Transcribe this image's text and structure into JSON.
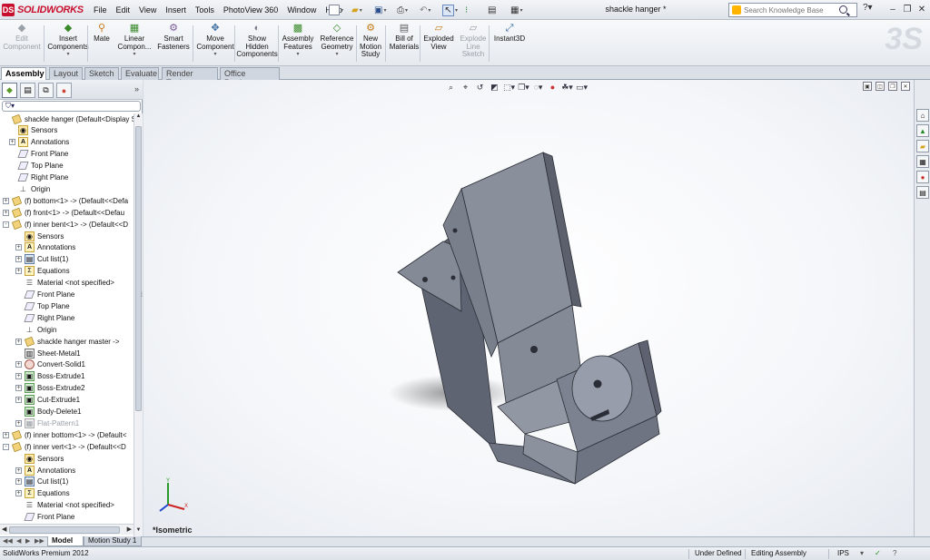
{
  "app": {
    "brand": "SOLIDWORKS",
    "brand_mark": "DS",
    "doc_title": "shackle hanger *"
  },
  "menu": [
    "File",
    "Edit",
    "View",
    "Insert",
    "Tools",
    "PhotoView 360",
    "Window",
    "Help"
  ],
  "search": {
    "placeholder": "Search Knowledge Base"
  },
  "commands": [
    {
      "l1": "Edit",
      "l2": "Component",
      "disabled": true
    },
    {
      "l1": "Insert",
      "l2": "Components",
      "disabled": false
    },
    {
      "l1": "Mate",
      "l2": "",
      "disabled": false
    },
    {
      "l1": "Linear",
      "l2": "Compon...",
      "disabled": false
    },
    {
      "l1": "Smart",
      "l2": "Fasteners",
      "disabled": false
    },
    {
      "l1": "Move",
      "l2": "Component",
      "disabled": false
    },
    {
      "l1": "Show",
      "l2": "Hidden",
      "l3": "Components",
      "disabled": false
    },
    {
      "l1": "Assembly",
      "l2": "Features",
      "disabled": false
    },
    {
      "l1": "Reference",
      "l2": "Geometry",
      "disabled": false
    },
    {
      "l1": "New",
      "l2": "Motion",
      "l3": "Study",
      "disabled": false
    },
    {
      "l1": "Bill of",
      "l2": "Materials",
      "disabled": false
    },
    {
      "l1": "Exploded",
      "l2": "View",
      "disabled": false
    },
    {
      "l1": "Explode",
      "l2": "Line",
      "l3": "Sketch",
      "disabled": true
    },
    {
      "l1": "Instant3D",
      "l2": "",
      "disabled": false
    }
  ],
  "tabs": [
    "Assembly",
    "Layout",
    "Sketch",
    "Evaluate",
    "Render Tools",
    "Office Products"
  ],
  "tree": [
    {
      "label": "shackle hanger  (Default<Display Stat",
      "icon": "assembly",
      "indent": 0,
      "exp": ""
    },
    {
      "label": "Sensors",
      "icon": "sensors",
      "indent": 1,
      "exp": ""
    },
    {
      "label": "Annotations",
      "icon": "annotations",
      "indent": 1,
      "exp": "+"
    },
    {
      "label": "Front Plane",
      "icon": "plane",
      "indent": 1,
      "exp": ""
    },
    {
      "label": "Top Plane",
      "icon": "plane",
      "indent": 1,
      "exp": ""
    },
    {
      "label": "Right Plane",
      "icon": "plane",
      "indent": 1,
      "exp": ""
    },
    {
      "label": "Origin",
      "icon": "origin",
      "indent": 1,
      "exp": ""
    },
    {
      "label": "(f) bottom<1> -> (Default<<Defa",
      "icon": "part",
      "indent": 0,
      "exp": "+"
    },
    {
      "label": "(f) front<1> -> (Default<<Defau",
      "icon": "part",
      "indent": 0,
      "exp": "+"
    },
    {
      "label": "(f) inner bent<1> -> (Default<<D",
      "icon": "part",
      "indent": 0,
      "exp": "-"
    },
    {
      "label": "Sensors",
      "icon": "sensors",
      "indent": 2,
      "exp": ""
    },
    {
      "label": "Annotations",
      "icon": "annotations",
      "indent": 2,
      "exp": "+"
    },
    {
      "label": "Cut list(1)",
      "icon": "cutlist",
      "indent": 2,
      "exp": "+"
    },
    {
      "label": "Equations",
      "icon": "equations",
      "indent": 2,
      "exp": "+"
    },
    {
      "label": "Material <not specified>",
      "icon": "material",
      "indent": 2,
      "exp": ""
    },
    {
      "label": "Front Plane",
      "icon": "plane",
      "indent": 2,
      "exp": ""
    },
    {
      "label": "Top Plane",
      "icon": "plane",
      "indent": 2,
      "exp": ""
    },
    {
      "label": "Right Plane",
      "icon": "plane",
      "indent": 2,
      "exp": ""
    },
    {
      "label": "Origin",
      "icon": "origin",
      "indent": 2,
      "exp": ""
    },
    {
      "label": "shackle hanger master ->",
      "icon": "part",
      "indent": 2,
      "exp": "+"
    },
    {
      "label": "Sheet-Metal1",
      "icon": "sheetmetal",
      "indent": 2,
      "exp": ""
    },
    {
      "label": "Convert-Solid1",
      "icon": "convert",
      "indent": 2,
      "exp": "+"
    },
    {
      "label": "Boss-Extrude1",
      "icon": "feature",
      "indent": 2,
      "exp": "+"
    },
    {
      "label": "Boss-Extrude2",
      "icon": "feature",
      "indent": 2,
      "exp": "+"
    },
    {
      "label": "Cut-Extrude1",
      "icon": "feature",
      "indent": 2,
      "exp": "+"
    },
    {
      "label": "Body-Delete1",
      "icon": "feature",
      "indent": 2,
      "exp": ""
    },
    {
      "label": "Flat-Pattern1",
      "icon": "flat",
      "indent": 2,
      "exp": "+",
      "dim": true
    },
    {
      "label": "(f) inner bottom<1> -> (Default<",
      "icon": "part",
      "indent": 0,
      "exp": "+"
    },
    {
      "label": "(f) inner vert<1> -> (Default<<D",
      "icon": "part",
      "indent": 0,
      "exp": "-"
    },
    {
      "label": "Sensors",
      "icon": "sensors",
      "indent": 2,
      "exp": ""
    },
    {
      "label": "Annotations",
      "icon": "annotations",
      "indent": 2,
      "exp": "+"
    },
    {
      "label": "Cut list(1)",
      "icon": "cutlist",
      "indent": 2,
      "exp": "+"
    },
    {
      "label": "Equations",
      "icon": "equations",
      "indent": 2,
      "exp": "+"
    },
    {
      "label": "Material <not specified>",
      "icon": "material",
      "indent": 2,
      "exp": ""
    },
    {
      "label": "Front Plane",
      "icon": "plane",
      "indent": 2,
      "exp": ""
    }
  ],
  "viewport": {
    "view_label": "*Isometric"
  },
  "bottom_tabs": [
    "Model",
    "Motion Study 1"
  ],
  "status": {
    "product": "SolidWorks Premium 2012",
    "state": "Under Defined",
    "mode": "Editing Assembly",
    "units": "IPS"
  },
  "colors": {
    "brand_red": "#c8102e",
    "part_fill": "#7c8190",
    "viewport_bg": "#f4f6f9"
  }
}
